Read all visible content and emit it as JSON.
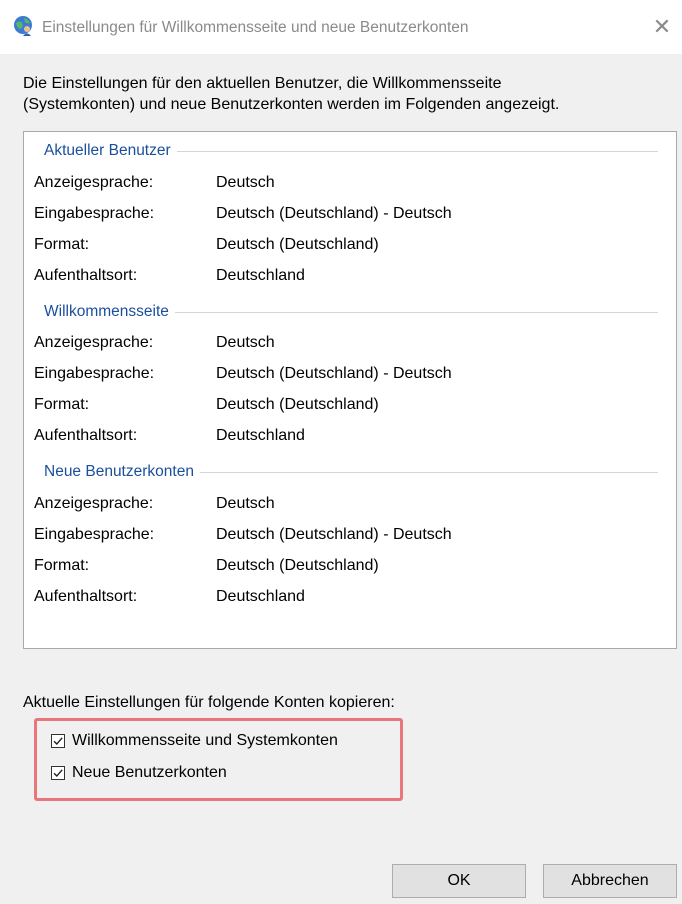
{
  "window": {
    "title": "Einstellungen für Willkommensseite und neue Benutzerkonten",
    "icon": "globe-user-icon",
    "close_glyph": "✕"
  },
  "description": {
    "line1": "Die Einstellungen für den aktuellen Benutzer, die Willkommensseite",
    "line2": "(Systemkonten) und neue Benutzerkonten werden im Folgenden angezeigt."
  },
  "sections": [
    {
      "title": "Aktueller Benutzer",
      "rows": [
        {
          "key": "Anzeigesprache:",
          "value": "Deutsch"
        },
        {
          "key": "Eingabesprache:",
          "value": "Deutsch (Deutschland) - Deutsch"
        },
        {
          "key": "Format:",
          "value": "Deutsch (Deutschland)"
        },
        {
          "key": "Aufenthaltsort:",
          "value": "Deutschland"
        }
      ]
    },
    {
      "title": "Willkommensseite",
      "rows": [
        {
          "key": "Anzeigesprache:",
          "value": "Deutsch"
        },
        {
          "key": "Eingabesprache:",
          "value": "Deutsch (Deutschland) - Deutsch"
        },
        {
          "key": "Format:",
          "value": "Deutsch (Deutschland)"
        },
        {
          "key": "Aufenthaltsort:",
          "value": "Deutschland"
        }
      ]
    },
    {
      "title": "Neue Benutzerkonten",
      "rows": [
        {
          "key": "Anzeigesprache:",
          "value": "Deutsch"
        },
        {
          "key": "Eingabesprache:",
          "value": "Deutsch (Deutschland) - Deutsch"
        },
        {
          "key": "Format:",
          "value": "Deutsch (Deutschland)"
        },
        {
          "key": "Aufenthaltsort:",
          "value": "Deutschland"
        }
      ]
    }
  ],
  "copy": {
    "label": "Aktuelle Einstellungen für folgende Konten kopieren:",
    "options": [
      {
        "label": "Willkommensseite und Systemkonten",
        "checked": true
      },
      {
        "label": "Neue Benutzerkonten",
        "checked": true
      }
    ],
    "highlight_color": "#e8777c"
  },
  "buttons": {
    "ok": "OK",
    "cancel": "Abbrechen"
  },
  "colors": {
    "section_title": "#1a4f9c",
    "dialog_bg": "#f0f0f0",
    "button_bg": "#e1e1e1"
  }
}
